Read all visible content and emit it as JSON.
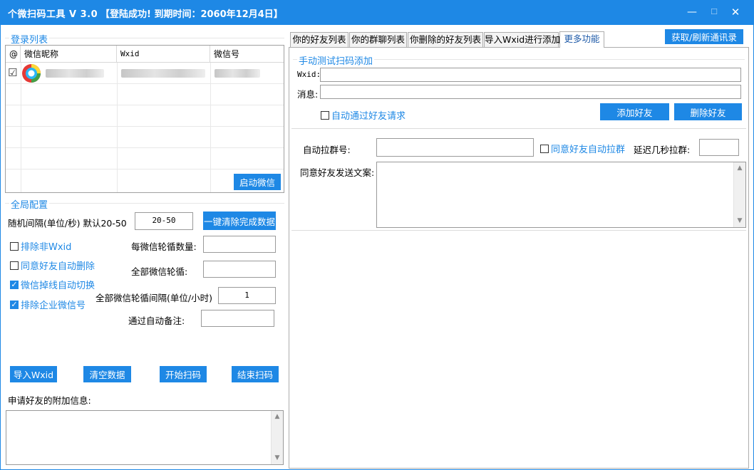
{
  "window": {
    "title": "个微扫码工具 V 3.0",
    "status": "【登陆成功! 到期时间：2060年12月4日】",
    "minimize": "—",
    "maximize": "☐",
    "close": "✕"
  },
  "login_list": {
    "group_title": "登录列表",
    "columns": [
      "@",
      "微信昵称",
      "Wxid",
      "微信号"
    ],
    "row_checked": "☑",
    "start_wechat_button": "启动微信"
  },
  "global_config": {
    "group_title": "全局配置",
    "random_interval_label": "随机间隔(单位/秒) 默认20-50",
    "random_interval_value": "20-50",
    "clear_done_button": "一键清除完成数据",
    "exclude_non_wxid": "排除非Wxid",
    "agree_auto_delete": "同意好友自动删除",
    "offline_auto_switch": "微信掉线自动切换",
    "exclude_enterprise": "排除企业微信号",
    "per_wechat_rounds_label": "每微信轮循数量:",
    "all_wechat_rounds_label": "全部微信轮循:",
    "all_interval_label": "全部微信轮循间隔(单位/小时)",
    "all_interval_value": "1",
    "auto_remark_label": "通过自动备注:"
  },
  "actions": {
    "import_wxid": "导入Wxid",
    "clear_data": "清空数据",
    "start_scan": "开始扫码",
    "end_scan": "结束扫码"
  },
  "extra_info": {
    "label": "申请好友的附加信息:"
  },
  "tabs": [
    {
      "label": "你的好友列表"
    },
    {
      "label": "你的群聊列表"
    },
    {
      "label": "你删除的好友列表"
    },
    {
      "label": "导入Wxid进行添加"
    },
    {
      "label": "更多功能"
    }
  ],
  "refresh_contacts_button": "获取/刷新通讯录",
  "manual_test": {
    "group_title": "手动测试扫码添加",
    "wxid_label": "Wxid:",
    "message_label": "消息:",
    "auto_accept": "自动通过好友请求",
    "add_friend_button": "添加好友",
    "delete_friend_button": "删除好友"
  },
  "auto_group": {
    "auto_pull_label": "自动拉群号:",
    "agree_auto_pull": "同意好友自动拉群",
    "delay_label": "延迟几秒拉群:",
    "send_text_label": "同意好友发送文案:"
  },
  "icons": {
    "scroll_up": "▲",
    "scroll_down": "▼"
  }
}
